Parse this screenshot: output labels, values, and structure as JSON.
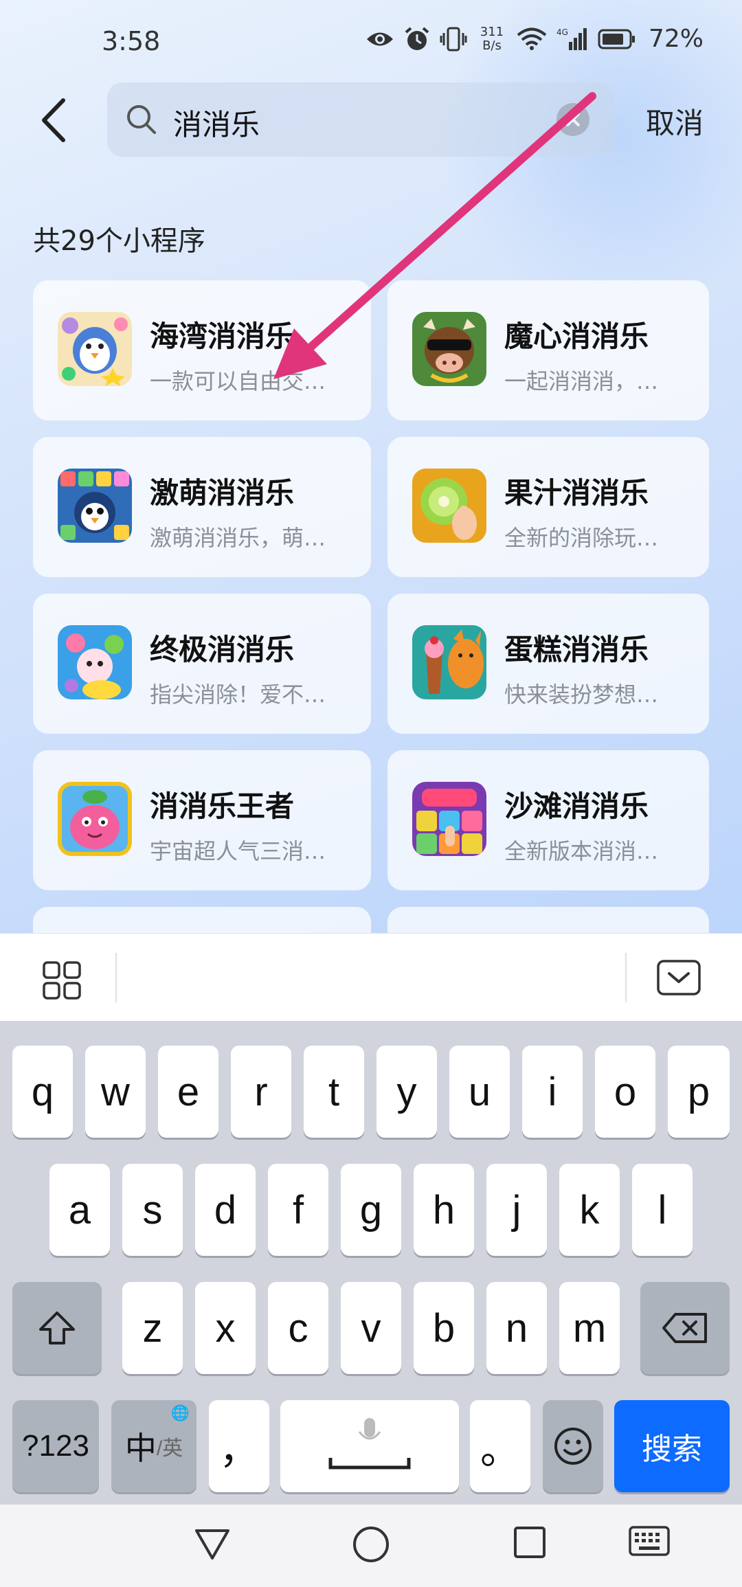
{
  "status_bar": {
    "time": "3:58",
    "net_speed_value": "311",
    "net_speed_unit": "B/s",
    "network_type": "4G",
    "battery": "72%",
    "icons": [
      "eye-icon",
      "alarm-icon",
      "vibrate-icon",
      "wifi-icon",
      "signal-icon",
      "battery-icon"
    ]
  },
  "header": {
    "search_query": "消消乐",
    "cancel_label": "取消"
  },
  "results": {
    "count_label": "共29个小程序",
    "items": [
      {
        "name": "海湾消消乐",
        "desc": "一款可以自由交…",
        "icon": "penguin-candy-icon"
      },
      {
        "name": "魔心消消乐",
        "desc": "一起消消消，…",
        "icon": "cool-cow-icon"
      },
      {
        "name": "激萌消消乐",
        "desc": "激萌消消乐，萌…",
        "icon": "penguin-blocks-icon"
      },
      {
        "name": "果汁消消乐",
        "desc": "全新的消除玩…",
        "icon": "kiwi-fruit-icon"
      },
      {
        "name": "终极消消乐",
        "desc": "指尖消除！爱不…",
        "icon": "cute-pets-icon"
      },
      {
        "name": "蛋糕消消乐",
        "desc": "快来装扮梦想…",
        "icon": "fox-cake-icon"
      },
      {
        "name": "消消乐王者",
        "desc": "宇宙超人气三消…",
        "icon": "pink-blob-icon"
      },
      {
        "name": "沙滩消消乐",
        "desc": "全新版本消消…",
        "icon": "beach-gems-icon"
      }
    ]
  },
  "keyboard": {
    "row1": [
      "q",
      "w",
      "e",
      "r",
      "t",
      "y",
      "u",
      "i",
      "o",
      "p"
    ],
    "row2": [
      "a",
      "s",
      "d",
      "f",
      "g",
      "h",
      "j",
      "k",
      "l"
    ],
    "row3": [
      "z",
      "x",
      "c",
      "v",
      "b",
      "n",
      "m"
    ],
    "symbols_key": "?123",
    "lang_main": "中",
    "lang_alt": "/英",
    "comma_key": "，",
    "period_key": "。",
    "search_key": "搜索"
  },
  "colors": {
    "accent_blue": "#0d6bff",
    "arrow_pink": "#e0357a"
  }
}
